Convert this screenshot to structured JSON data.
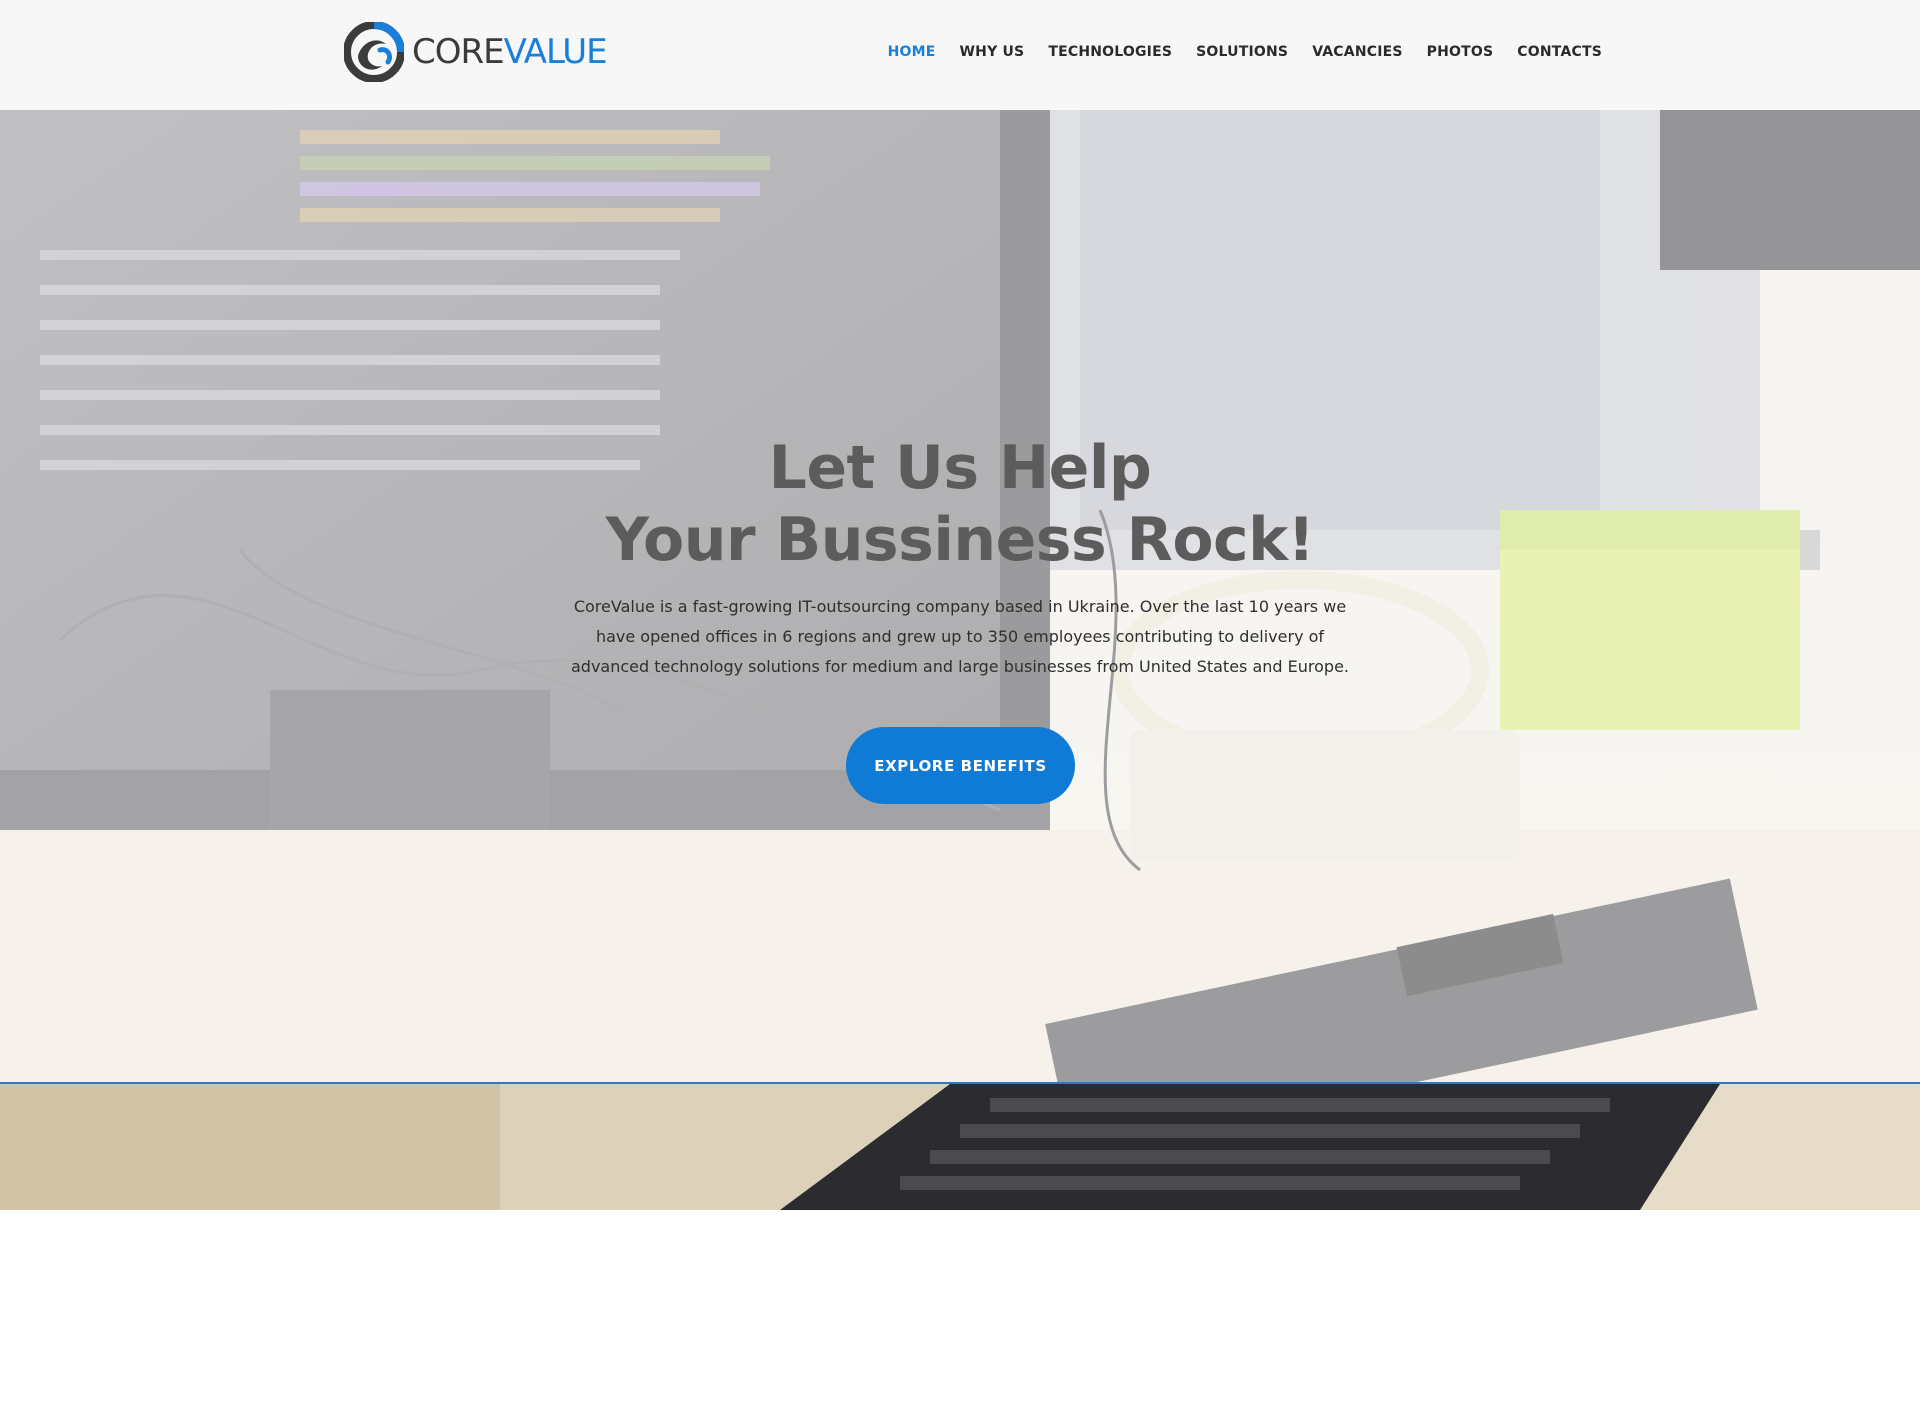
{
  "header": {
    "logo": {
      "core_text": "CORE",
      "value_text": "VALUE",
      "icon": "corevalue-logo-icon"
    },
    "nav": [
      {
        "label": "HOME",
        "active": true
      },
      {
        "label": "WHY US",
        "active": false
      },
      {
        "label": "TECHNOLOGIES",
        "active": false
      },
      {
        "label": "SOLUTIONS",
        "active": false
      },
      {
        "label": "VACANCIES",
        "active": false
      },
      {
        "label": "PHOTOS",
        "active": false
      },
      {
        "label": "CONTACTS",
        "active": false
      }
    ]
  },
  "hero": {
    "title_line1": "Let Us Help",
    "title_line2": "Your Bussiness Rock!",
    "description": "CoreValue is a fast-growing IT-outsourcing company based in Ukraine. Over the last 10 years we have opened offices in 6 regions and grew up to 350 employees contributing to delivery of advanced technology solutions for medium and large businesses from United States and Europe.",
    "cta_label": "EXPLORE  BENEFITS"
  },
  "colors": {
    "accent": "#1a7fd8",
    "button": "#0f7bd6",
    "header_bg": "#f7f7f7",
    "title": "#5c5c5c",
    "divider": "#2f78c4"
  }
}
